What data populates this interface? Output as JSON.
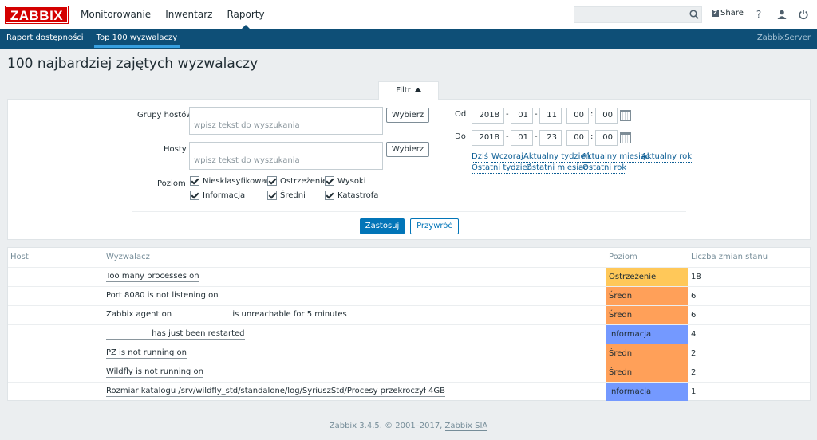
{
  "header": {
    "logo": "ZABBIX",
    "nav": [
      "Monitorowanie",
      "Inwentarz",
      "Raporty"
    ],
    "share_label": "Share",
    "help_icon": "question-icon",
    "user_icon": "user-icon",
    "logout_icon": "power-icon"
  },
  "subnav": {
    "items": [
      "Raport dostępności",
      "Top 100 wyzwalaczy"
    ],
    "server": "ZabbixServer"
  },
  "page": {
    "title": "100 najbardziej zajętych wyzwalaczy"
  },
  "filter": {
    "tab_label": "Filtr",
    "host_groups_label": "Grupy hostów",
    "hosts_label": "Hosty",
    "placeholder": "wpisz tekst do wyszukania",
    "select_label": "Wybierz",
    "level_label": "Poziom",
    "levels": [
      "Niesklasyfikowane",
      "Ostrzeżenie",
      "Wysoki",
      "Informacja",
      "Średni",
      "Katastrofa"
    ],
    "from_label": "Od",
    "to_label": "Do",
    "from": {
      "year": "2018",
      "month": "01",
      "day": "11",
      "hour": "00",
      "minute": "00"
    },
    "to": {
      "year": "2018",
      "month": "01",
      "day": "23",
      "hour": "00",
      "minute": "00"
    },
    "quick_row1": [
      "Dziś",
      "Wczoraj",
      "Aktualny tydzień",
      "Aktualny miesiąc",
      "Aktualny rok"
    ],
    "quick_row2": [
      "Ostatni tydzień",
      "Ostatni miesiąc",
      "Ostatni rok"
    ],
    "apply_label": "Zastosuj",
    "reset_label": "Przywróć"
  },
  "table": {
    "headers": [
      "Host",
      "Wyzwalacz",
      "Poziom",
      "Liczba zmian stanu"
    ],
    "rows": [
      {
        "trigger": "Too many processes on",
        "severity": "Ostrzeżenie",
        "color": "#ffc859",
        "count": "18"
      },
      {
        "trigger": "Port 8080 is not listening on",
        "severity": "Średni",
        "color": "#ffa059",
        "count": "6"
      },
      {
        "trigger": "Zabbix agent on                        is unreachable for 5 minutes",
        "severity": "Średni",
        "color": "#ffa059",
        "count": "6"
      },
      {
        "trigger": "                  has just been restarted",
        "severity": "Informacja",
        "color": "#7499ff",
        "count": "4"
      },
      {
        "trigger": "PZ is not running on",
        "severity": "Średni",
        "color": "#ffa059",
        "count": "2"
      },
      {
        "trigger": "Wildfly is not running on",
        "severity": "Średni",
        "color": "#ffa059",
        "count": "2"
      },
      {
        "trigger": "Rozmiar katalogu /srv/wildfly_std/standalone/log/SyriuszStd/Procesy przekroczył 4GB",
        "severity": "Informacja",
        "color": "#7499ff",
        "count": "1"
      }
    ]
  },
  "footer": {
    "text": "Zabbix 3.4.5. © 2001–2017,",
    "link": "Zabbix SIA"
  }
}
